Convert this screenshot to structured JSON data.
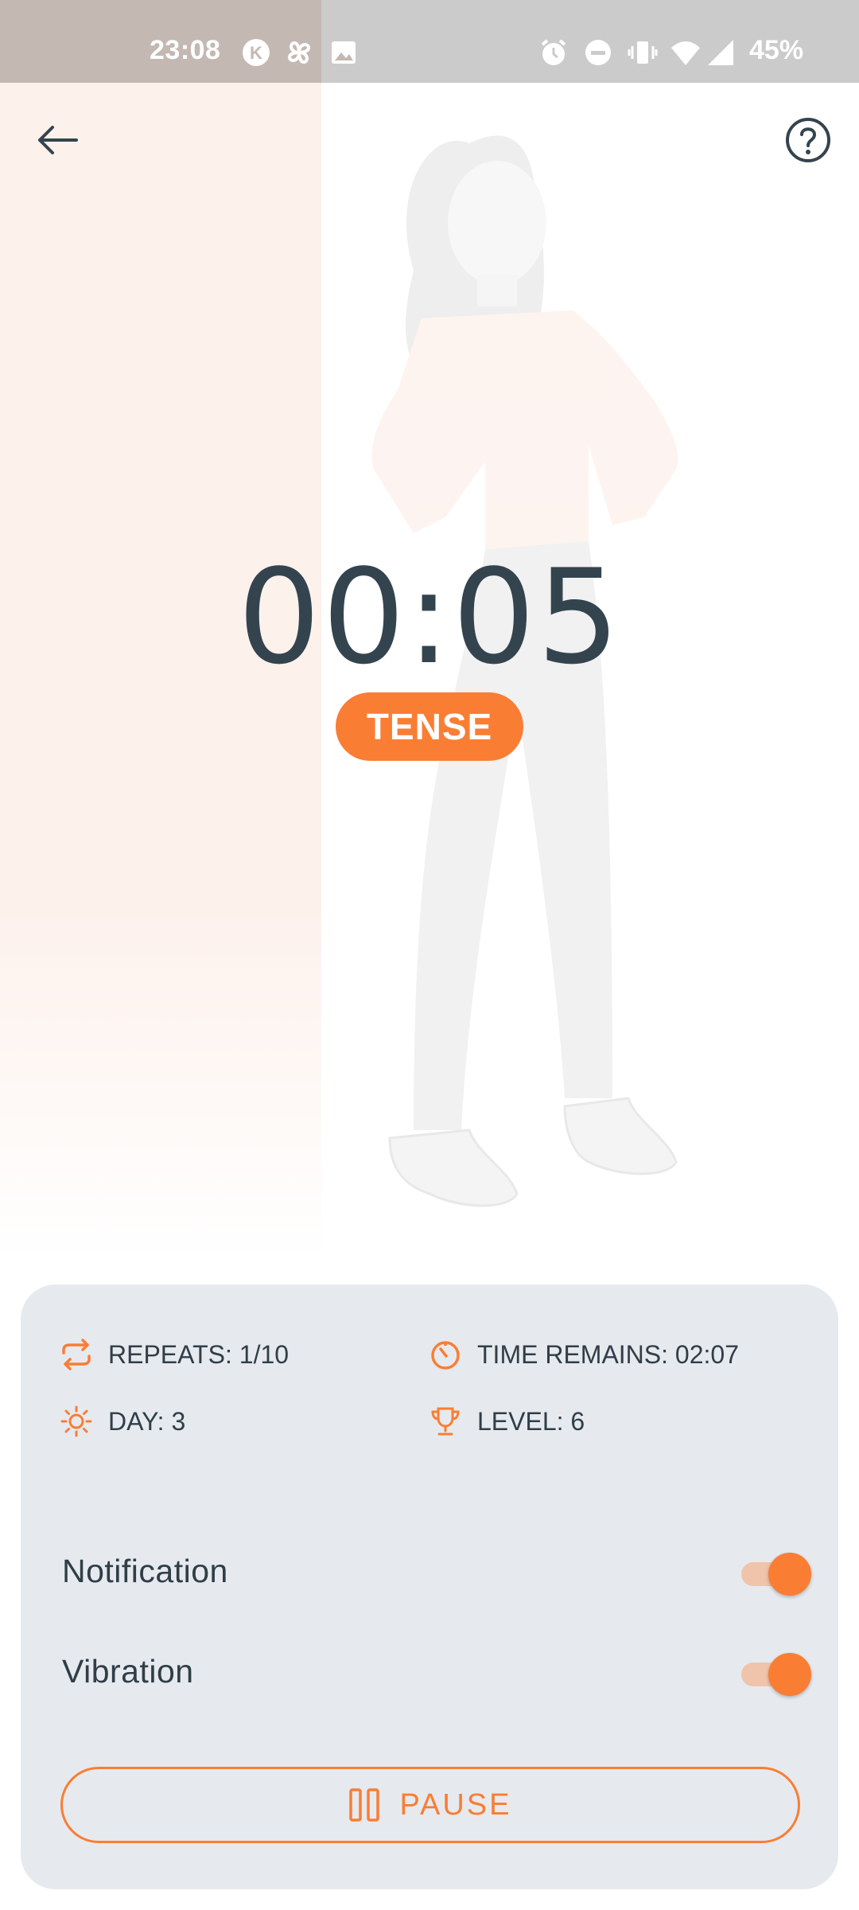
{
  "status_bar": {
    "time": "23:08",
    "battery": "45%",
    "icons": [
      "k-app-icon",
      "pinwheel-icon",
      "image-icon",
      "alarm-icon",
      "dnd-icon",
      "vibrate-icon",
      "wifi-icon",
      "signal-icon"
    ]
  },
  "header": {
    "back_icon": "arrow-left-icon",
    "help_icon": "help-circle-icon"
  },
  "timer": {
    "value": "00:05",
    "phase": "TENSE"
  },
  "stats": {
    "repeats": "REPEATS: 1/10",
    "time_remains": "TIME REMAINS: 02:07",
    "day": "DAY: 3",
    "level": "LEVEL: 6"
  },
  "settings": {
    "notification_label": "Notification",
    "notification_on": true,
    "vibration_label": "Vibration",
    "vibration_on": true
  },
  "actions": {
    "pause_label": "PAUSE"
  },
  "colors": {
    "accent": "#fa7d34",
    "text": "#2f3e48",
    "card_bg": "#e6eaee",
    "panel_tint": "#fdf1ec"
  }
}
